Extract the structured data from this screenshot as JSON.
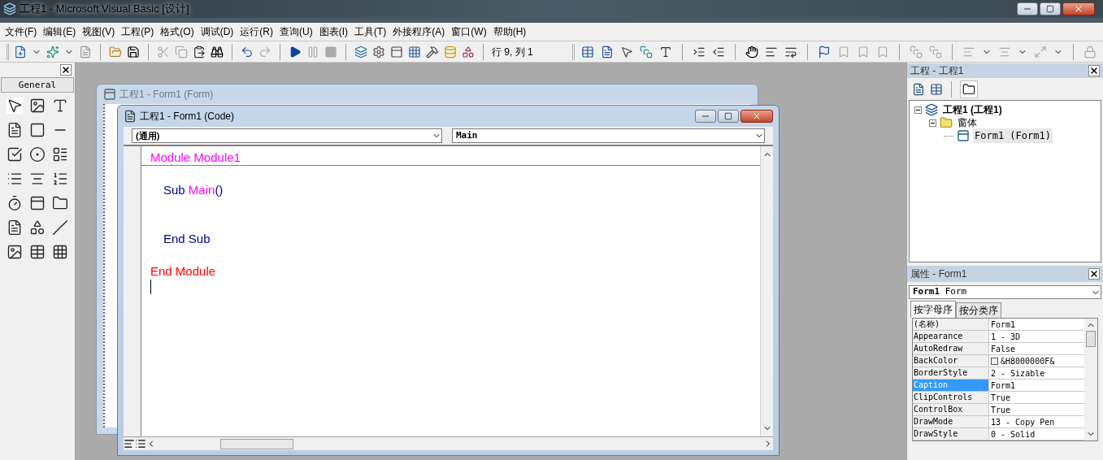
{
  "window": {
    "title": "工程1 - Microsoft Visual Basic [设计]"
  },
  "menu": [
    "文件(F)",
    "编辑(E)",
    "视图(V)",
    "工程(P)",
    "格式(O)",
    "调试(D)",
    "运行(R)",
    "查询(U)",
    "图表(I)",
    "工具(T)",
    "外接程序(A)",
    "窗口(W)",
    "帮助(H)"
  ],
  "toolbar": {
    "position": "行 9, 列 1"
  },
  "toolbox": {
    "tab": "General"
  },
  "form_window": {
    "title": "工程1 - Form1 (Form)"
  },
  "code_window": {
    "title": "工程1 - Form1 (Code)",
    "object_box": "(通用)",
    "procedure_box": "Main",
    "lines": [
      {
        "kind": "code",
        "indented": false,
        "separator_below": true,
        "segments": [
          {
            "text": "Module Module1",
            "color": "#ff00ff"
          }
        ]
      },
      {
        "kind": "blank"
      },
      {
        "kind": "code",
        "indented": true,
        "separator_below": false,
        "segments": [
          {
            "text": "Sub ",
            "color": "#00008b"
          },
          {
            "text": "Main",
            "color": "#ff00ff"
          },
          {
            "text": "()",
            "color": "#00008b"
          }
        ]
      },
      {
        "kind": "blank"
      },
      {
        "kind": "blank"
      },
      {
        "kind": "code",
        "indented": true,
        "separator_below": false,
        "segments": [
          {
            "text": "End Sub",
            "color": "#00008b"
          }
        ]
      },
      {
        "kind": "blank"
      },
      {
        "kind": "code",
        "indented": false,
        "separator_below": false,
        "segments": [
          {
            "text": "End Module",
            "color": "#ff0000"
          }
        ]
      }
    ]
  },
  "project": {
    "title": "工程 - 工程1",
    "folders_toggle_on": true,
    "tree": [
      {
        "label": "工程1 (工程1)",
        "kind": "project",
        "expanded": true,
        "children": [
          {
            "label": "窗体",
            "kind": "folder",
            "expanded": true,
            "children": [
              {
                "label": "Form1 (Form1)",
                "kind": "form",
                "selected": true
              }
            ]
          }
        ]
      }
    ]
  },
  "properties": {
    "title": "属性 - Form1",
    "object": "**Form1** Form",
    "tabs": [
      {
        "label": "按字母序",
        "selected": true
      },
      {
        "label": "按分类序",
        "selected": false
      }
    ],
    "rows": [
      {
        "name": "(名称)",
        "value": "Form1",
        "selected": false
      },
      {
        "name": "Appearance",
        "value": "1 - 3D",
        "selected": false
      },
      {
        "name": "AutoRedraw",
        "value": "False",
        "selected": false
      },
      {
        "name": "BackColor",
        "value": "&H8000000F&",
        "selected": false,
        "color": "#f0f0f0"
      },
      {
        "name": "BorderStyle",
        "value": "2 - Sizable",
        "selected": false
      },
      {
        "name": "Caption",
        "value": "Form1",
        "selected": true
      },
      {
        "name": "ClipControls",
        "value": "True",
        "selected": false
      },
      {
        "name": "ControlBox",
        "value": "True",
        "selected": false
      },
      {
        "name": "DrawMode",
        "value": "13 - Copy Pen",
        "selected": false
      },
      {
        "name": "DrawStyle",
        "value": "0 - Solid",
        "selected": false
      }
    ]
  }
}
